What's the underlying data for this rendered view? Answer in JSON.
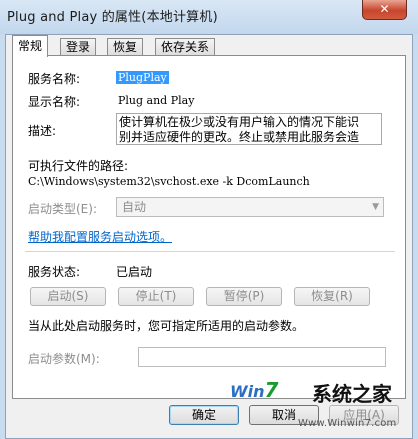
{
  "window": {
    "title": "Plug and Play 的属性(本地计算机)",
    "close_glyph": "✕"
  },
  "tabs": [
    {
      "label": "常规",
      "active": true
    },
    {
      "label": "登录",
      "active": false
    },
    {
      "label": "恢复",
      "active": false
    },
    {
      "label": "依存关系",
      "active": false
    }
  ],
  "general": {
    "service_name_label": "服务名称:",
    "service_name_value": "PlugPlay",
    "display_name_label": "显示名称:",
    "display_name_value": "Plug and Play",
    "description_label": "描述:",
    "description_value": "使计算机在极少或没有用户输入的情况下能识别并适应硬件的更改。终止或禁用此服务会造成系统不稳定。",
    "exe_path_label": "可执行文件的路径:",
    "exe_path_value": "C:\\Windows\\system32\\svchost.exe -k DcomLaunch",
    "startup_type_label": "启动类型(E):",
    "startup_type_value": "自动",
    "help_link": "帮助我配置服务启动选项。",
    "status_label": "服务状态:",
    "status_value": "已启动",
    "buttons": {
      "start": "启动(S)",
      "stop": "停止(T)",
      "pause": "暂停(P)",
      "resume": "恢复(R)"
    },
    "start_hint": "当从此处启动服务时，您可指定所适用的启动参数。",
    "start_params_label": "启动参数(M):",
    "start_params_value": ""
  },
  "dialog_buttons": {
    "ok": "确定",
    "cancel": "取消",
    "apply": "应用(A)"
  },
  "watermark": {
    "logo_prefix": "Win",
    "logo_seven": "7",
    "name": "系统之家",
    "url": "Www.Winwin7.com"
  }
}
